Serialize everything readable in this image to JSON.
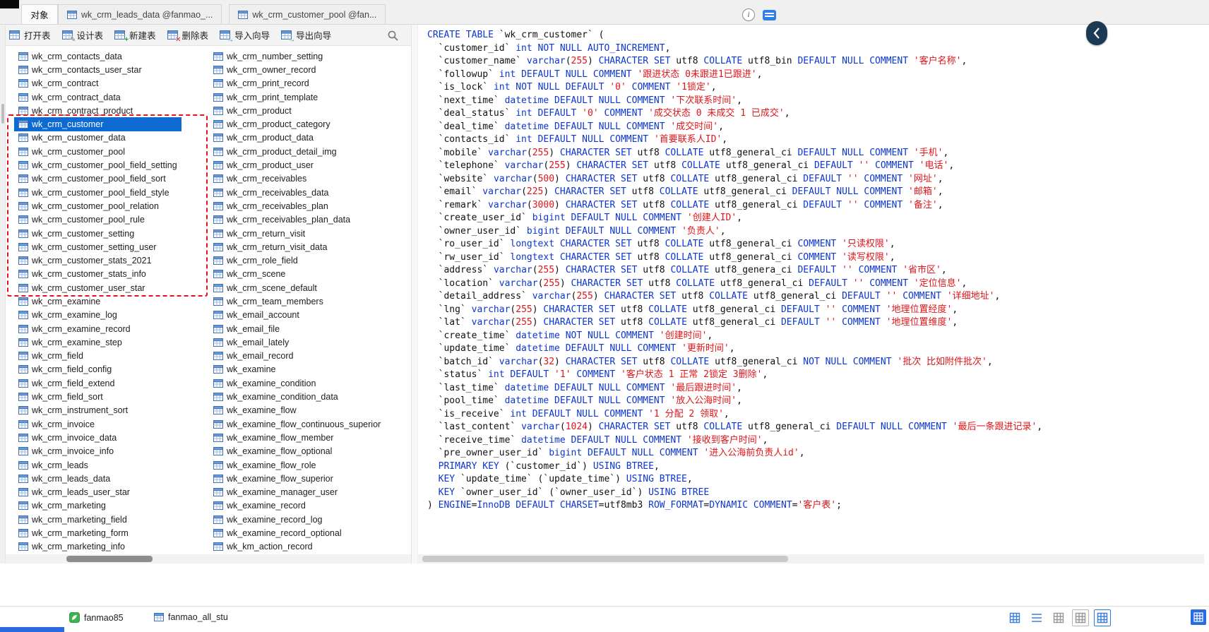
{
  "tabs": {
    "objects_label": "对象",
    "open_tabs": [
      "wk_crm_leads_data @fanmao_...",
      "wk_crm_customer_pool @fan..."
    ]
  },
  "toolbar": {
    "buttons": [
      {
        "id": "open",
        "label": "打开表",
        "glyph": ""
      },
      {
        "id": "design",
        "label": "设计表",
        "glyph": "✎"
      },
      {
        "id": "new",
        "label": "新建表",
        "glyph": "+"
      },
      {
        "id": "delete",
        "label": "删除表",
        "glyph": "✕"
      },
      {
        "id": "import",
        "label": "导入向导",
        "glyph": "→"
      },
      {
        "id": "export",
        "label": "导出向导",
        "glyph": "→"
      }
    ]
  },
  "table_list": {
    "selected": "wk_crm_customer",
    "column1": [
      "wk_crm_contacts_data",
      "wk_crm_contacts_user_star",
      "wk_crm_contract",
      "wk_crm_contract_data",
      "wk_crm_contract_product",
      "wk_crm_customer",
      "wk_crm_customer_data",
      "wk_crm_customer_pool",
      "wk_crm_customer_pool_field_setting",
      "wk_crm_customer_pool_field_sort",
      "wk_crm_customer_pool_field_style",
      "wk_crm_customer_pool_relation",
      "wk_crm_customer_pool_rule",
      "wk_crm_customer_setting",
      "wk_crm_customer_setting_user",
      "wk_crm_customer_stats_2021",
      "wk_crm_customer_stats_info",
      "wk_crm_customer_user_star",
      "wk_crm_examine",
      "wk_crm_examine_log",
      "wk_crm_examine_record",
      "wk_crm_examine_step",
      "wk_crm_field",
      "wk_crm_field_config",
      "wk_crm_field_extend",
      "wk_crm_field_sort",
      "wk_crm_instrument_sort",
      "wk_crm_invoice",
      "wk_crm_invoice_data",
      "wk_crm_invoice_info",
      "wk_crm_leads",
      "wk_crm_leads_data",
      "wk_crm_leads_user_star",
      "wk_crm_marketing",
      "wk_crm_marketing_field",
      "wk_crm_marketing_form",
      "wk_crm_marketing_info"
    ],
    "column2": [
      "wk_crm_number_setting",
      "wk_crm_owner_record",
      "wk_crm_print_record",
      "wk_crm_print_template",
      "wk_crm_product",
      "wk_crm_product_category",
      "wk_crm_product_data",
      "wk_crm_product_detail_img",
      "wk_crm_product_user",
      "wk_crm_receivables",
      "wk_crm_receivables_data",
      "wk_crm_receivables_plan",
      "wk_crm_receivables_plan_data",
      "wk_crm_return_visit",
      "wk_crm_return_visit_data",
      "wk_crm_role_field",
      "wk_crm_scene",
      "wk_crm_scene_default",
      "wk_crm_team_members",
      "wk_email_account",
      "wk_email_file",
      "wk_email_lately",
      "wk_email_record",
      "wk_examine",
      "wk_examine_condition",
      "wk_examine_condition_data",
      "wk_examine_flow",
      "wk_examine_flow_continuous_superior",
      "wk_examine_flow_member",
      "wk_examine_flow_optional",
      "wk_examine_flow_role",
      "wk_examine_flow_superior",
      "wk_examine_manager_user",
      "wk_examine_record",
      "wk_examine_record_log",
      "wk_examine_record_optional",
      "wk_km_action_record"
    ]
  },
  "sql_view": {
    "lines": [
      "CREATE TABLE `wk_crm_customer` (",
      "  `customer_id` int NOT NULL AUTO_INCREMENT,",
      "  `customer_name` varchar(255) CHARACTER SET utf8 COLLATE utf8_bin DEFAULT NULL COMMENT '客户名称',",
      "  `followup` int DEFAULT NULL COMMENT '跟进状态 0未跟进1已跟进',",
      "  `is_lock` int NOT NULL DEFAULT '0' COMMENT '1锁定',",
      "  `next_time` datetime DEFAULT NULL COMMENT '下次联系时间',",
      "  `deal_status` int DEFAULT '0' COMMENT '成交状态 0 未成交 1 已成交',",
      "  `deal_time` datetime DEFAULT NULL COMMENT '成交时间',",
      "  `contacts_id` int DEFAULT NULL COMMENT '首要联系人ID',",
      "  `mobile` varchar(255) CHARACTER SET utf8 COLLATE utf8_general_ci DEFAULT NULL COMMENT '手机',",
      "  `telephone` varchar(255) CHARACTER SET utf8 COLLATE utf8_general_ci DEFAULT '' COMMENT '电话',",
      "  `website` varchar(500) CHARACTER SET utf8 COLLATE utf8_general_ci DEFAULT '' COMMENT '网址',",
      "  `email` varchar(225) CHARACTER SET utf8 COLLATE utf8_general_ci DEFAULT NULL COMMENT '邮箱',",
      "  `remark` varchar(3000) CHARACTER SET utf8 COLLATE utf8_general_ci DEFAULT '' COMMENT '备注',",
      "  `create_user_id` bigint DEFAULT NULL COMMENT '创建人ID',",
      "  `owner_user_id` bigint DEFAULT NULL COMMENT '负责人',",
      "  `ro_user_id` longtext CHARACTER SET utf8 COLLATE utf8_general_ci COMMENT '只读权限',",
      "  `rw_user_id` longtext CHARACTER SET utf8 COLLATE utf8_general_ci COMMENT '读写权限',",
      "  `address` varchar(255) CHARACTER SET utf8 COLLATE utf8_genera_ci DEFAULT '' COMMENT '省市区',",
      "  `location` varchar(255) CHARACTER SET utf8 COLLATE utf8_general_ci DEFAULT '' COMMENT '定位信息',",
      "  `detail_address` varchar(255) CHARACTER SET utf8 COLLATE utf8_general_ci DEFAULT '' COMMENT '详细地址',",
      "  `lng` varchar(255) CHARACTER SET utf8 COLLATE utf8_general_ci DEFAULT '' COMMENT '地理位置经度',",
      "  `lat` varchar(255) CHARACTER SET utf8 COLLATE utf8_general_ci DEFAULT '' COMMENT '地理位置维度',",
      "  `create_time` datetime NOT NULL COMMENT '创建时间',",
      "  `update_time` datetime DEFAULT NULL COMMENT '更新时间',",
      "  `batch_id` varchar(32) CHARACTER SET utf8 COLLATE utf8_general_ci NOT NULL COMMENT '批次 比如附件批次',",
      "  `status` int DEFAULT '1' COMMENT '客户状态 1 正常 2锁定 3删除',",
      "  `last_time` datetime DEFAULT NULL COMMENT '最后跟进时间',",
      "  `pool_time` datetime DEFAULT NULL COMMENT '放入公海时间',",
      "  `is_receive` int DEFAULT NULL COMMENT '1 分配 2 领取',",
      "  `last_content` varchar(1024) CHARACTER SET utf8 COLLATE utf8_general_ci DEFAULT NULL COMMENT '最后一条跟进记录',",
      "  `receive_time` datetime DEFAULT NULL COMMENT '接收到客户时间',",
      "  `pre_owner_user_id` bigint DEFAULT NULL COMMENT '进入公海前负责人id',",
      "  PRIMARY KEY (`customer_id`) USING BTREE,",
      "  KEY `update_time` (`update_time`) USING BTREE,",
      "  KEY `owner_user_id` (`owner_user_id`) USING BTREE",
      ") ENGINE=InnoDB DEFAULT CHARSET=utf8mb3 ROW_FORMAT=DYNAMIC COMMENT='客户表';"
    ]
  },
  "status_bar": {
    "connection": "fanmao85",
    "database": "fanmao_all_stu",
    "view_buttons": [
      {
        "icon": "grid",
        "tone": "blue",
        "boxed": false
      },
      {
        "icon": "list",
        "tone": "blue",
        "boxed": false
      },
      {
        "icon": "grid",
        "tone": "gray",
        "boxed": false
      },
      {
        "icon": "grid",
        "tone": "gray",
        "boxed": true
      },
      {
        "icon": "grid",
        "tone": "blue",
        "boxed": true
      }
    ]
  },
  "icons": {
    "info_glyph": "i"
  },
  "colors": {
    "keyword": "#0c36d0",
    "string": "#e01419",
    "number": "#e01419",
    "selection_bg": "#0e6ad3",
    "dash_box": "#e8101c",
    "accent_blue": "#2a6be0",
    "connection_green": "#3cb44f"
  }
}
